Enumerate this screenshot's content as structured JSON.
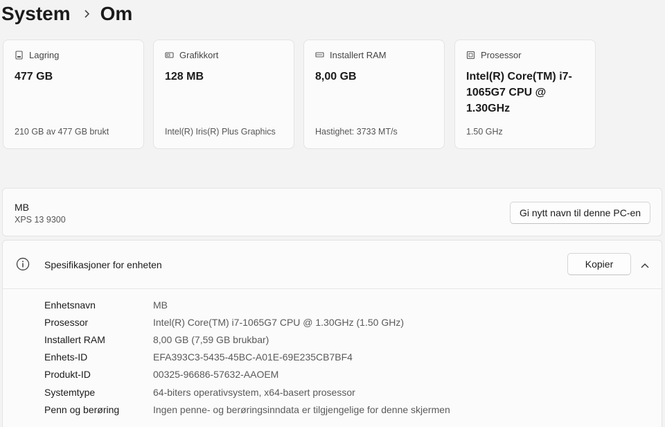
{
  "breadcrumb": {
    "parent": "System",
    "current": "Om"
  },
  "cards": [
    {
      "label": "Lagring",
      "value": "477 GB",
      "sub": "210 GB av 477 GB brukt",
      "icon": "storage-icon"
    },
    {
      "label": "Grafikkort",
      "value": "128 MB",
      "sub": "Intel(R) Iris(R) Plus Graphics",
      "icon": "graphics-card-icon"
    },
    {
      "label": "Installert RAM",
      "value": "8,00 GB",
      "sub": "Hastighet: 3733 MT/s",
      "icon": "ram-icon"
    },
    {
      "label": "Prosessor",
      "value": "Intel(R) Core(TM) i7-1065G7 CPU @ 1.30GHz",
      "sub": "1.50 GHz",
      "icon": "processor-icon"
    }
  ],
  "device": {
    "name": "MB",
    "model": "XPS 13 9300",
    "rename_button": "Gi nytt navn til denne PC-en"
  },
  "specs": {
    "title": "Spesifikasjoner for enheten",
    "copy_button": "Kopier",
    "rows": [
      {
        "key": "Enhetsnavn",
        "value": "MB"
      },
      {
        "key": "Prosessor",
        "value": "Intel(R) Core(TM) i7-1065G7 CPU @ 1.30GHz (1.50 GHz)"
      },
      {
        "key": "Installert RAM",
        "value": "8,00 GB (7,59 GB brukbar)"
      },
      {
        "key": "Enhets-ID",
        "value": "EFA393C3-5435-45BC-A01E-69E235CB7BF4"
      },
      {
        "key": "Produkt-ID",
        "value": "00325-96686-57632-AAOEM"
      },
      {
        "key": "Systemtype",
        "value": "64-biters operativsystem, x64-basert prosessor"
      },
      {
        "key": "Penn og berøring",
        "value": "Ingen penne- og berøringsinndata er tilgjengelige for denne skjermen"
      }
    ]
  }
}
